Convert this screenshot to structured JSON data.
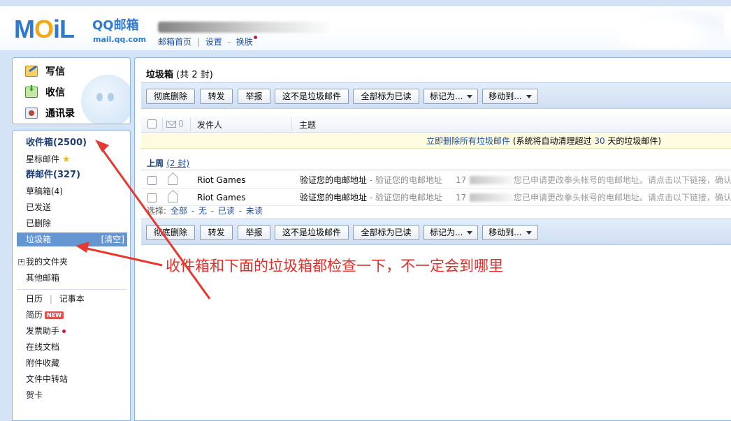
{
  "header": {
    "logo_text": "MOiL",
    "logo_brand": "QQ邮箱",
    "logo_site": "mail.qq.com",
    "links": [
      "邮箱首页",
      "设置",
      "换肤"
    ],
    "link_separator": "|",
    "link_dash": "-"
  },
  "quick_actions": {
    "write": "写信",
    "receive": "收信",
    "contacts": "通讯录"
  },
  "folders": {
    "inbox": "收件箱(2500)",
    "starred": "星标邮件",
    "group": "群邮件(327)",
    "drafts": "草稿箱(4)",
    "sent": "已发送",
    "deleted": "已删除",
    "spam": "垃圾箱",
    "spam_clear": "[清空]",
    "my_folders": "我的文件夹",
    "other": "其他邮箱"
  },
  "tools": {
    "calendar": "日历",
    "notes": "记事本",
    "resume": "简历",
    "resume_badge": "NEW",
    "invoice": "发票助手",
    "docs": "在线文档",
    "attachments": "附件收藏",
    "transfer": "文件中转站",
    "cards": "贺卡"
  },
  "main": {
    "title": "垃圾箱",
    "count": "(共 2 封)",
    "toolbar": {
      "delete": "彻底删除",
      "forward": "转发",
      "report": "举报",
      "not_spam": "这不是垃圾邮件",
      "mark_all_read": "全部标为已读",
      "mark_as": "标记为...",
      "move_to": "移动到..."
    },
    "columns": {
      "sender": "发件人",
      "subject": "主题"
    },
    "notice": {
      "link": "立即删除所有垃圾邮件",
      "pre": " (系统将自动清理超过 ",
      "days": "30",
      "post": " 天的垃圾邮件)"
    },
    "group": {
      "label": "上周",
      "count": "(2 封)"
    },
    "emails": [
      {
        "sender": "Riot Games",
        "subject": "验证您的电邮地址",
        "preview_subject": " - 验证您的电邮地址",
        "time_prefix": "17",
        "preview": "您已申请更改拳头帐号的电邮地址。请点击以下链接，确认"
      },
      {
        "sender": "Riot Games",
        "subject": "验证您的电邮地址",
        "preview_subject": " - 验证您的电邮地址",
        "time_prefix": "17",
        "preview": "您已申请更改拳头帐号的电邮地址。请点击以下链接，确认"
      }
    ],
    "select": {
      "label": "选择:",
      "all": "全部",
      "none": "无",
      "read": "已读",
      "unread": "未读"
    }
  },
  "annotation": "收件箱和下面的垃圾箱都检查一下，不一定会到哪里",
  "colors": {
    "accent": "#6596d2",
    "link": "#1e50a2",
    "annotation": "#e0302a"
  }
}
